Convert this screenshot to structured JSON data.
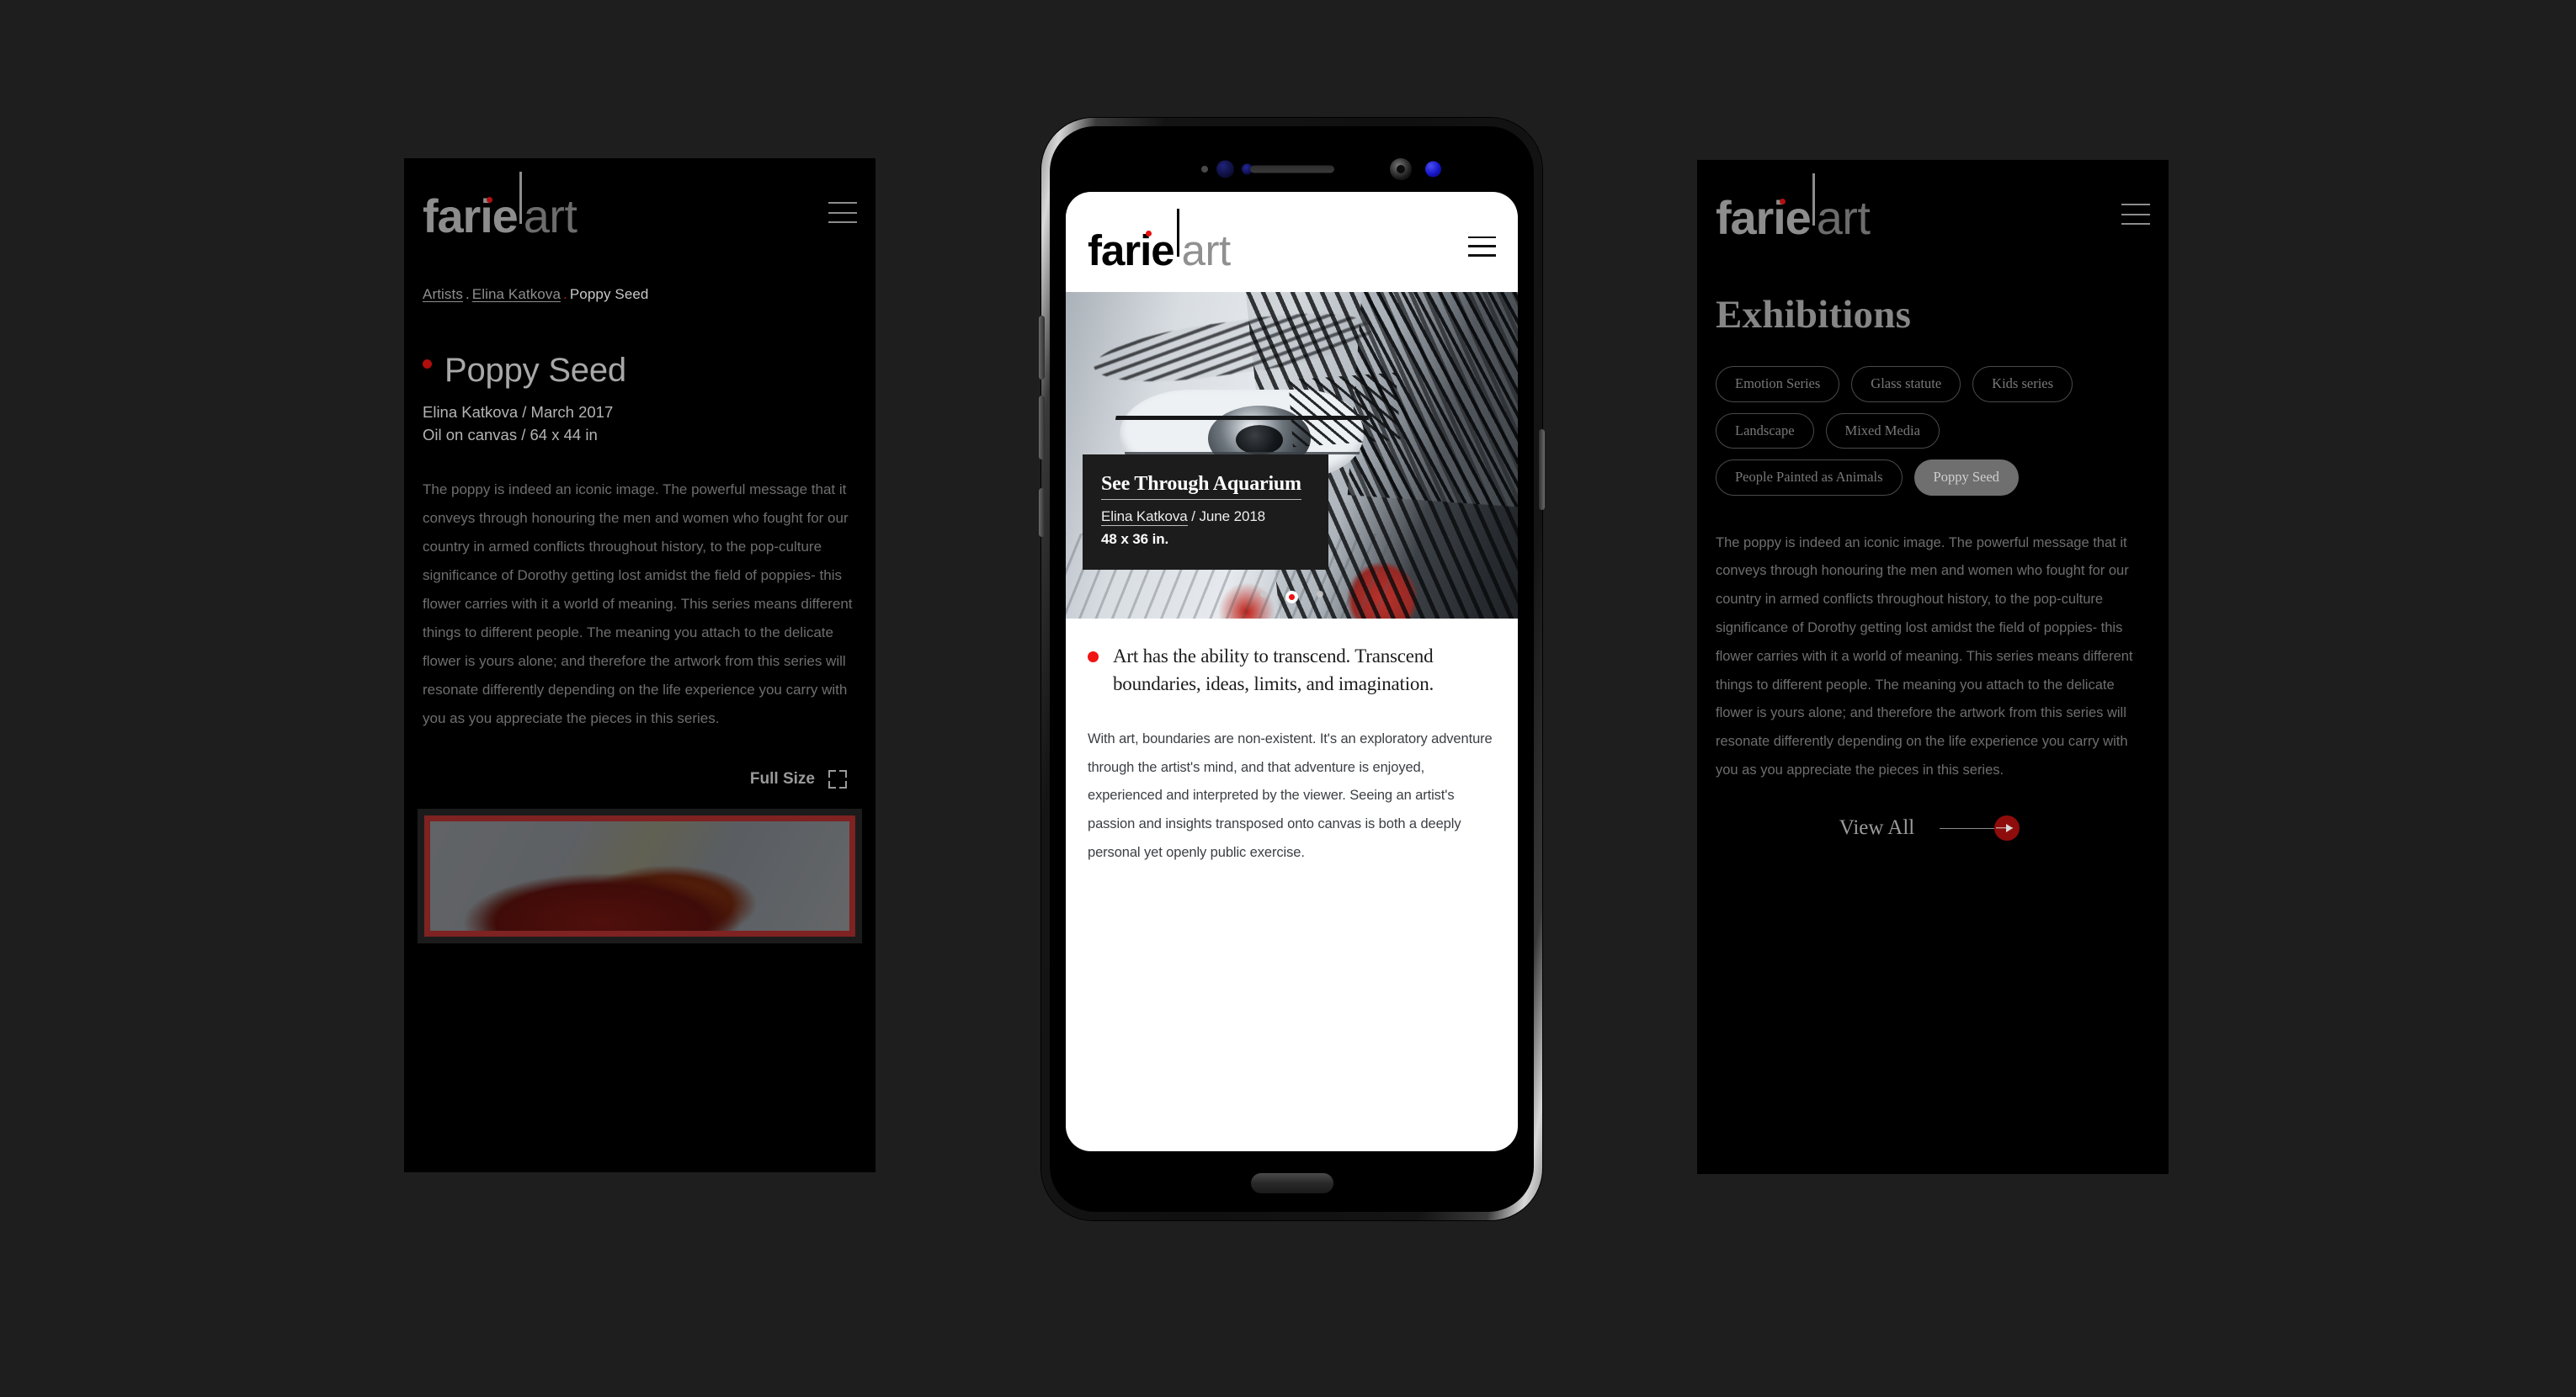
{
  "brand": {
    "part1": "farie",
    "part2": "art",
    "accent_color": "#b31010"
  },
  "left_panel": {
    "menu_icon": "hamburger-icon",
    "breadcrumb": {
      "item1": "Artists",
      "sep1": ".",
      "item2": "Elina Katkova",
      "sep2": ".",
      "current": "Poppy Seed"
    },
    "artwork": {
      "title": "Poppy Seed",
      "artist_and_date": "Elina Katkova / March 2017",
      "medium_and_size": "Oil on canvas / 64 x 44 in",
      "description": "The poppy is indeed an iconic image. The powerful message that it conveys through honouring the men and women who fought for our country in armed conflicts throughout history, to the pop-culture significance of Dorothy getting lost amidst the field of poppies- this flower carries with it a world of meaning. This series means different things to different people. The meaning you attach to the delicate flower is yours alone; and therefore the artwork from this series will resonate differently depending on the life experience you carry with you as you appreciate the pieces in this series."
    },
    "full_size_label": "Full Size",
    "full_size_icon": "expand-icon"
  },
  "phone": {
    "menu_icon": "hamburger-icon",
    "hero": {
      "image_alt": "grayscale painting of an eye",
      "card_title": "See Through Aquarium",
      "card_artist": "Elina Katkova",
      "card_separator": "/",
      "card_date": "June 2018",
      "card_dimensions": "48 x 36 in.",
      "carousel_dots": 3,
      "carousel_active_index": 1
    },
    "quote": "Art has the ability to transcend. Transcend boundaries, ideas, limits, and imagination.",
    "body": "With art, boundaries are non-existent. It's an exploratory adventure through the artist's mind, and that adventure is enjoyed, experienced and interpreted by the viewer. Seeing an artist's passion and insights transposed onto canvas is both a deeply personal yet openly public exercise."
  },
  "right_panel": {
    "menu_icon": "hamburger-icon",
    "heading": "Exhibitions",
    "tags": [
      {
        "label": "Emotion Series",
        "selected": false
      },
      {
        "label": "Glass statute",
        "selected": false
      },
      {
        "label": "Kids series",
        "selected": false
      },
      {
        "label": "Landscape",
        "selected": false
      },
      {
        "label": "Mixed Media",
        "selected": false
      },
      {
        "label": "People Painted as Animals",
        "selected": false
      },
      {
        "label": "Poppy Seed",
        "selected": true
      }
    ],
    "description": "The poppy is indeed an iconic image. The powerful message that it conveys through honouring the men and women who fought for our country in armed conflicts throughout history, to the pop-culture significance of Dorothy getting lost amidst the field of poppies- this flower carries with it a world of meaning. This series means different things to different people. The meaning you attach to the delicate flower is yours alone; and therefore the artwork from this series will resonate differently depending on the life experience you carry with you as you appreciate the pieces in this series.",
    "view_all_label": "View All",
    "view_all_icon": "arrow-right-icon"
  }
}
